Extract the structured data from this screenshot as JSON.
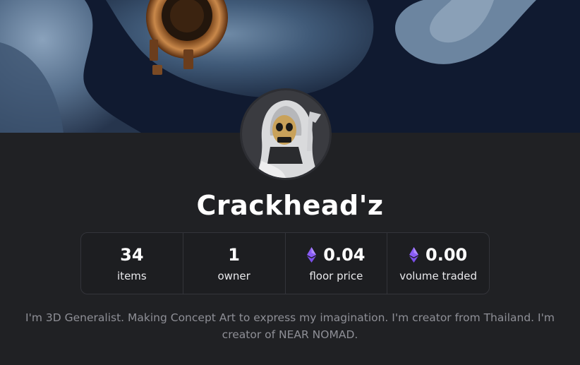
{
  "collection": {
    "name": "Crackhead'z",
    "bio": "I'm 3D Generalist. Making Concept Art to express my imagination. I'm creator from Thailand. I'm creator of NEAR NOMAD."
  },
  "stats": [
    {
      "value": "34",
      "label": "items",
      "icon": ""
    },
    {
      "value": "1",
      "label": "owner",
      "icon": ""
    },
    {
      "value": "0.04",
      "label": "floor price",
      "icon": "eth-icon"
    },
    {
      "value": "0.00",
      "label": "volume traded",
      "icon": "eth-icon"
    }
  ],
  "colors": {
    "background": "#202124",
    "eth_purple": "#8a5cf6",
    "muted_text": "#8e8f96"
  }
}
